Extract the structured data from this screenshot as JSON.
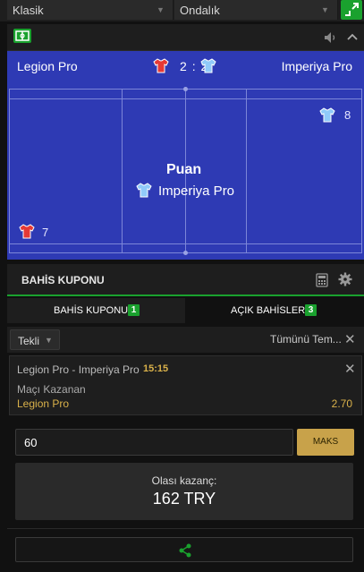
{
  "top": {
    "odds_type": "Klasik",
    "odds_format": "Ondalık"
  },
  "match": {
    "home": "Legion Pro",
    "away": "Imperiya Pro",
    "home_score": "2",
    "away_score": "2",
    "score_sep": ":",
    "event_title": "Puan",
    "event_team": "Imperiya Pro",
    "home_count": "7",
    "away_count": "8",
    "home_color": "#e53935",
    "away_color": "#90caf9"
  },
  "slip": {
    "title": "BAHİS KUPONU",
    "tabs": [
      {
        "label": "BAHİS KUPONU",
        "count": "1"
      },
      {
        "label": "AÇIK BAHİSLER",
        "count": "3"
      }
    ],
    "bet_type": "Tekli",
    "clear_all": "Tümünü Tem..."
  },
  "selection": {
    "match": "Legion Pro - Imperiya Pro",
    "time": "15:15",
    "market": "Maçı Kazanan",
    "pick": "Legion Pro",
    "odds": "2.70"
  },
  "stake": {
    "value": "60",
    "max_label": "MAKS"
  },
  "potential": {
    "label": "Olası kazanç:",
    "amount": "162 TRY"
  },
  "colors": {
    "accent": "#1aa12e",
    "gold": "#c8a24a",
    "pitch": "#2e3ab4"
  }
}
